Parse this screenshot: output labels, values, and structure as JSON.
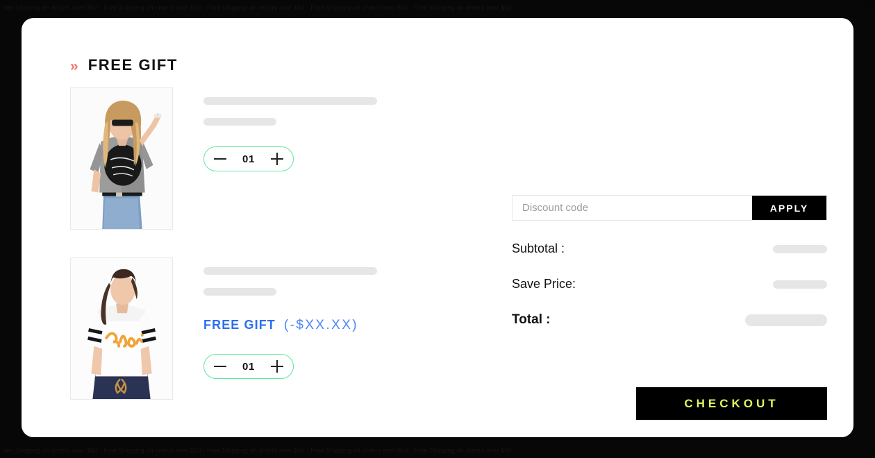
{
  "background": {
    "noise_top": "Free Shipping on orders over $50 · Free Shipping on orders over $50 · Free Shipping on orders over $50 · Free Shipping on orders over $50 · Free Shipping on orders over $50",
    "noise_bottom": "Free Shipping on orders over $50 · Free Shipping on orders over $50 · Free Shipping on orders over $50 · Free Shipping on orders over $50 · Free Shipping on orders over $50"
  },
  "header": {
    "chevron_glyph": "»",
    "title": "FREE GIFT",
    "chevron_color": "#f4796b"
  },
  "items": [
    {
      "image_alt": "woman-in-gray-graphic-tee",
      "line1": "",
      "line2": "",
      "gift": null,
      "quantity": "01",
      "decrement_label": "−",
      "increment_label": "+"
    },
    {
      "image_alt": "woman-in-white-barbie-tee",
      "line1": "",
      "line2": "",
      "gift": {
        "label": "FREE GIFT",
        "amount": "(-$XX.XX)",
        "label_color": "#2b6ff0",
        "amount_color": "#4a87f5"
      },
      "quantity": "01",
      "decrement_label": "−",
      "increment_label": "+"
    }
  ],
  "summary": {
    "discount": {
      "placeholder": "Discount code",
      "value": "",
      "apply_label": "APPLY"
    },
    "rows": [
      {
        "label": "Subtotal :",
        "value": ""
      },
      {
        "label": "Save Price:",
        "value": ""
      }
    ],
    "grand_total": {
      "label": "Total :",
      "value": ""
    },
    "checkout_label": "CHECKOUT",
    "checkout_bg": "#000000",
    "checkout_text_color": "#dff363"
  },
  "colors": {
    "frame": "#070707",
    "card": "#ffffff",
    "stepper_border": "#5fe79e",
    "skeleton": "#e6e6e6"
  }
}
